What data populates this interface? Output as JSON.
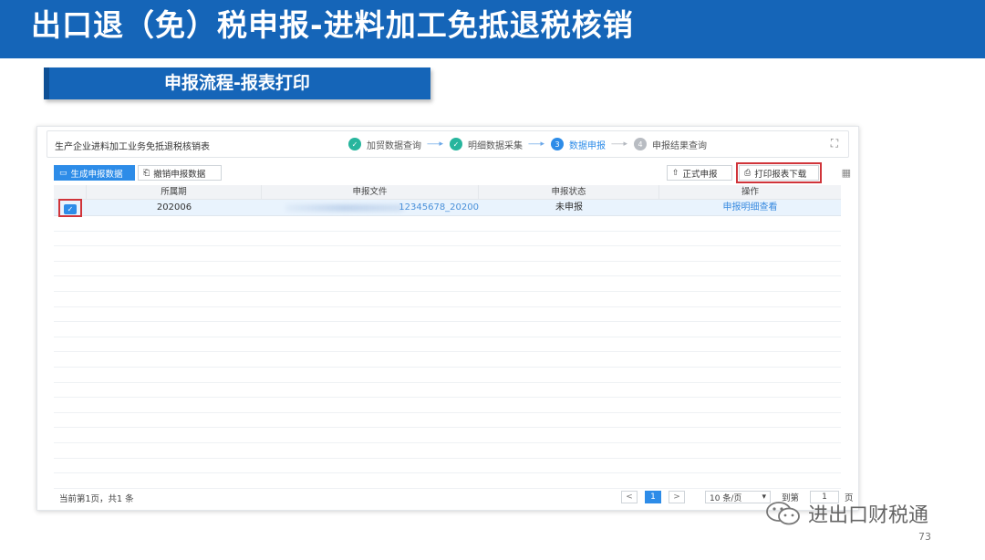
{
  "slide": {
    "title": "出口退（免）税申报-进料加工免抵退税核销",
    "subtitle": "申报流程-报表打印",
    "page_number": "73",
    "watermark": "进出口财税通"
  },
  "panel": {
    "title": "生产企业进料加工业务免抵退税核销表",
    "steps": [
      {
        "num": "✓",
        "label": "加贸数据查询",
        "state": "done"
      },
      {
        "num": "✓",
        "label": "明细数据采集",
        "state": "done"
      },
      {
        "num": "3",
        "label": "数据申报",
        "state": "active"
      },
      {
        "num": "4",
        "label": "申报结果查询",
        "state": "pending"
      }
    ],
    "arrow": "------▸"
  },
  "toolbar": {
    "generate_label": "生成申报数据",
    "revoke_label": "撤销申报数据",
    "formal_label": "正式申报",
    "print_label": "打印报表下载"
  },
  "table": {
    "headers": [
      "",
      "所属期",
      "申报文件",
      "申报状态",
      "操作"
    ],
    "rows": [
      {
        "period": "202006",
        "file": "12345678_20200",
        "status": "未申报",
        "action": "申报明细查看"
      }
    ]
  },
  "footer": {
    "summary": "当前第1页，共1 条",
    "current_page": "1",
    "page_size": "10 条/页",
    "goto_label": "到第",
    "goto_value": "1",
    "page_suffix": "页"
  },
  "colors": {
    "brand": "#1565b8",
    "primary": "#2d8ce8",
    "done": "#27b59d",
    "highlight": "#d0343a"
  }
}
